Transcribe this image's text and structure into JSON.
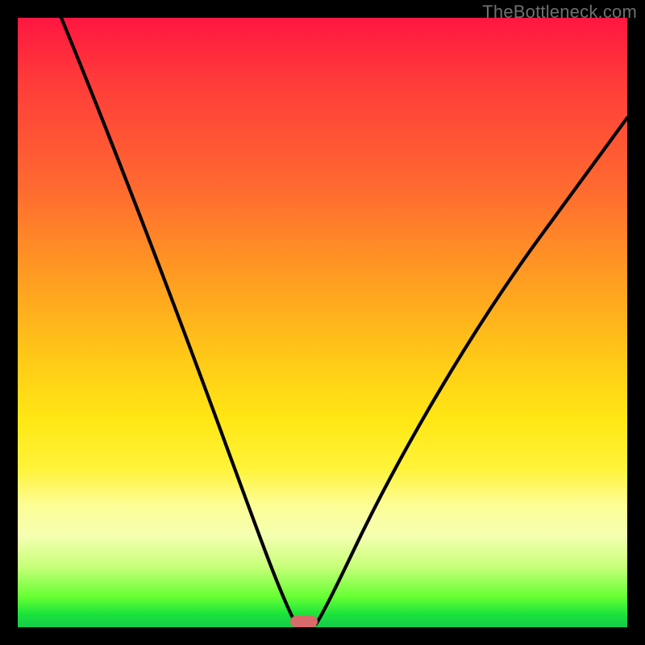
{
  "watermark": "TheBottleneck.com",
  "colors": {
    "frame": "#000000",
    "gradient_top": "#ff1640",
    "gradient_mid": "#ffe714",
    "gradient_bottom": "#17c94b",
    "curve": "#000000",
    "marker": "#d86a6a"
  },
  "chart_data": {
    "type": "line",
    "title": "",
    "xlabel": "",
    "ylabel": "",
    "xlim": [
      0,
      100
    ],
    "ylim": [
      0,
      100
    ],
    "grid": false,
    "legend": false,
    "series": [
      {
        "name": "bottleneck-curve",
        "x": [
          0,
          5,
          10,
          15,
          20,
          25,
          30,
          35,
          40,
          43,
          45,
          46,
          47,
          48,
          50,
          55,
          60,
          65,
          70,
          75,
          80,
          85,
          90,
          95,
          100
        ],
        "values": [
          100,
          91,
          82,
          73,
          63,
          53,
          43,
          31,
          18,
          8,
          3,
          1,
          0,
          0,
          2,
          8,
          16,
          24,
          32,
          39,
          46,
          53,
          59,
          66,
          71
        ]
      }
    ],
    "annotations": [
      {
        "name": "optimal-marker",
        "x": 47,
        "y": 0
      }
    ],
    "background_gradient": {
      "direction": "vertical",
      "stops": [
        {
          "pos": 0.0,
          "color": "#ff1640"
        },
        {
          "pos": 0.55,
          "color": "#ffe714"
        },
        {
          "pos": 0.85,
          "color": "#f4ffb0"
        },
        {
          "pos": 1.0,
          "color": "#17c94b"
        }
      ]
    }
  }
}
